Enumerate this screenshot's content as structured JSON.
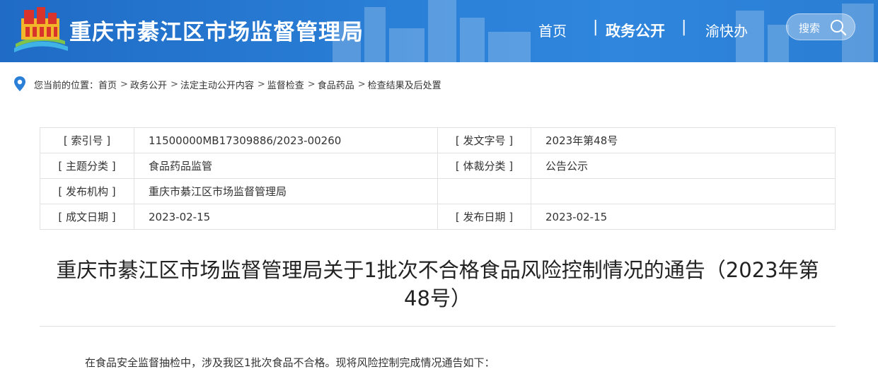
{
  "header": {
    "site_title": "重庆市綦江区市场监督管理局",
    "nav": {
      "home": "首页",
      "gov": "政务公开",
      "yu": "渝快办",
      "sep": "|"
    },
    "search_label": "搜索"
  },
  "breadcrumb": {
    "prefix": "您当前的位置：",
    "items": [
      "首页",
      "政务公开",
      "法定主动公开内容",
      "监督检查",
      "食品药品",
      "检查结果及后处置"
    ],
    "separator": ">"
  },
  "meta": {
    "rows": [
      {
        "k1": "[ 索引号 ]",
        "v1": "11500000MB17309886/2023-00260",
        "k2": "[ 发文字号 ]",
        "v2": "2023年第48号"
      },
      {
        "k1": "[ 主题分类 ]",
        "v1": "食品药品监管",
        "k2": "[ 体裁分类 ]",
        "v2": "公告公示"
      },
      {
        "k1": "[ 发布机构 ]",
        "v1": "重庆市綦江区市场监督管理局",
        "k2": "",
        "v2": ""
      },
      {
        "k1": "[ 成文日期 ]",
        "v1": "2023-02-15",
        "k2": "[ 发布日期 ]",
        "v2": "2023-02-15"
      }
    ]
  },
  "article": {
    "title_line1": "重庆市綦江区市场监督管理局关于1批次不合格食品风险控制情况的通告（2023年第",
    "title_line2": "48号）",
    "intro": "在食品安全监督抽检中，涉及我区1批次食品不合格。现将风险控制完成情况通告如下："
  },
  "colors": {
    "header_blue": "#2a7fd6",
    "accent_red": "#d9342b",
    "accent_yellow": "#f2b62b",
    "table_border": "#e1e1e1"
  }
}
